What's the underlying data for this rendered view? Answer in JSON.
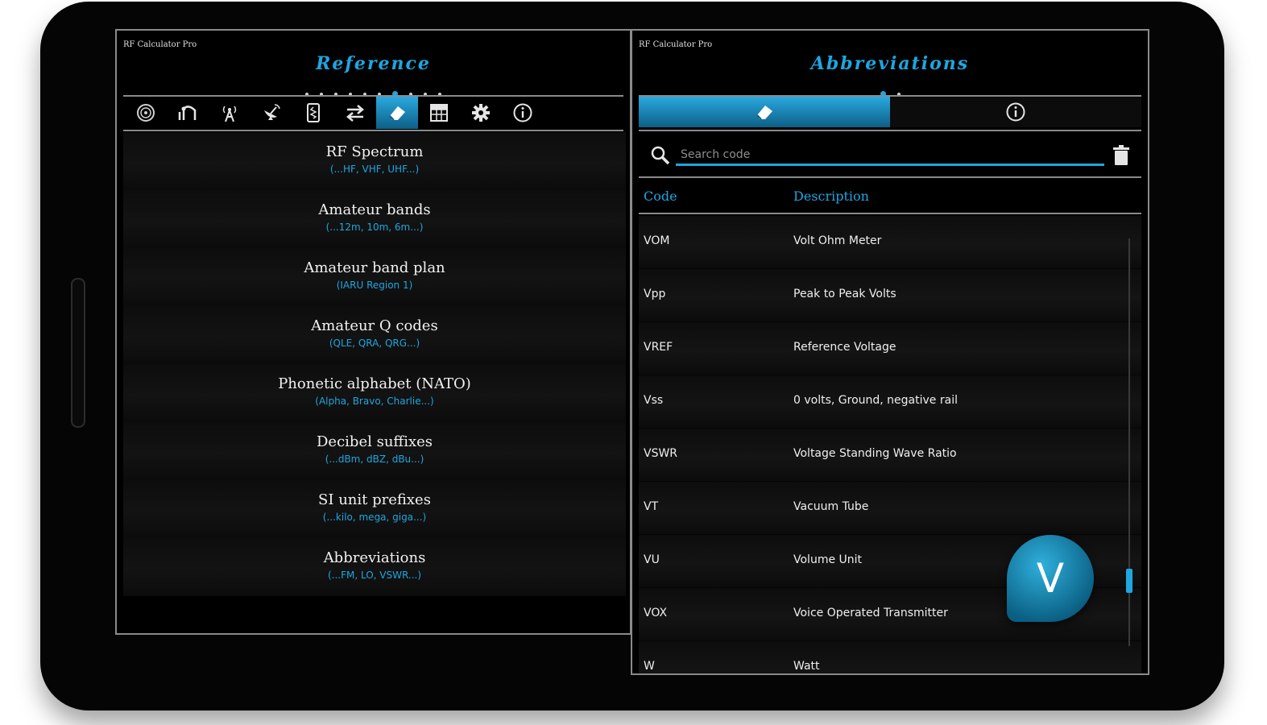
{
  "left": {
    "app_name": "RF Calculator Pro",
    "title": "Reference",
    "page_dots": 10,
    "active_dot": 6,
    "toolbar": [
      {
        "icon": "radio-icon"
      },
      {
        "icon": "signal-curve-icon"
      },
      {
        "icon": "antenna-icon"
      },
      {
        "icon": "satellite-dish-icon"
      },
      {
        "icon": "resistor-icon"
      },
      {
        "icon": "swap-arrows-icon"
      },
      {
        "icon": "eraser-icon",
        "active": true
      },
      {
        "icon": "table-icon"
      },
      {
        "icon": "gear-icon"
      },
      {
        "icon": "info-icon"
      }
    ],
    "items": [
      {
        "title": "RF Spectrum",
        "sub": "(...HF, VHF, UHF...)"
      },
      {
        "title": "Amateur bands",
        "sub": "(...12m, 10m, 6m...)"
      },
      {
        "title": "Amateur band plan",
        "sub": "(IARU Region 1)"
      },
      {
        "title": "Amateur Q codes",
        "sub": "(QLE, QRA, QRG...)"
      },
      {
        "title": "Phonetic alphabet (NATO)",
        "sub": "(Alpha, Bravo, Charlie...)"
      },
      {
        "title": "Decibel suffixes",
        "sub": "(...dBm, dBZ, dBu...)"
      },
      {
        "title": "SI unit prefixes",
        "sub": "(...kilo, mega, giga...)"
      },
      {
        "title": "Abbreviations",
        "sub": "(...FM, LO, VSWR...)"
      }
    ]
  },
  "right": {
    "app_name": "RF Calculator Pro",
    "title": "Abbreviations",
    "page_dots": 2,
    "active_dot": 0,
    "search_placeholder": "Search code",
    "col_code": "Code",
    "col_desc": "Description",
    "rows": [
      {
        "code": "VOM",
        "desc": "Volt Ohm Meter"
      },
      {
        "code": "Vpp",
        "desc": "Peak to Peak Volts"
      },
      {
        "code": "VREF",
        "desc": "Reference Voltage"
      },
      {
        "code": "Vss",
        "desc": "0 volts, Ground, negative rail"
      },
      {
        "code": "VSWR",
        "desc": "Voltage Standing Wave Ratio"
      },
      {
        "code": "VT",
        "desc": "Vacuum Tube"
      },
      {
        "code": "VU",
        "desc": "Volume Unit"
      },
      {
        "code": "VOX",
        "desc": "Voice Operated Transmitter"
      },
      {
        "code": "W",
        "desc": "Watt"
      }
    ],
    "badge_letter": "V"
  },
  "colors": {
    "accent": "#1ea6e0",
    "background": "#000000",
    "text": "#f2f2f2"
  }
}
